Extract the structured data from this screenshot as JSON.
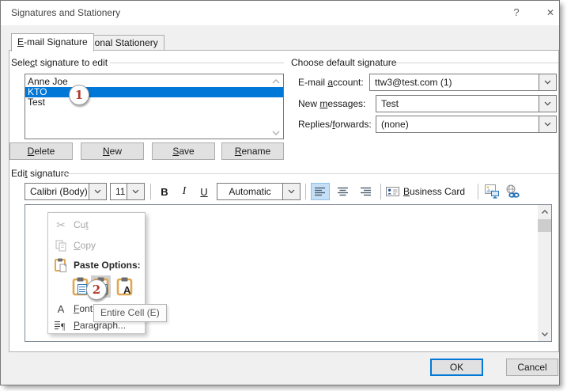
{
  "window": {
    "title": "Signatures and Stationery",
    "help_glyph": "?",
    "close_glyph": "✕"
  },
  "tabs": {
    "email": {
      "pre": "",
      "key": "E",
      "post": "-mail Signature"
    },
    "stationery": {
      "pre": "",
      "key": "P",
      "post": "ersonal Stationery"
    }
  },
  "select_group": {
    "label": {
      "pre": "Sele",
      "key": "c",
      "post": "t signature to edit"
    },
    "items": [
      "Anne Joe",
      "KTO",
      "Test"
    ],
    "selected_item": "KTO",
    "buttons": {
      "delete": {
        "pre": "",
        "key": "D",
        "post": "elete"
      },
      "new": {
        "pre": "",
        "key": "N",
        "post": "ew"
      },
      "save": {
        "pre": "",
        "key": "S",
        "post": "ave"
      },
      "rename": {
        "pre": "",
        "key": "R",
        "post": "ename"
      }
    }
  },
  "default_group": {
    "label": "Choose default signature",
    "email_account": {
      "label": {
        "pre": "E-mail ",
        "key": "a",
        "post": "ccount:"
      },
      "value": "ttw3@test.com (1)"
    },
    "new_messages": {
      "label": {
        "pre": "New ",
        "key": "m",
        "post": "essages:"
      },
      "value": "Test"
    },
    "replies_forwards": {
      "label": {
        "pre": "Replies/",
        "key": "f",
        "post": "orwards:"
      },
      "value": "(none)"
    }
  },
  "edit_group": {
    "label": {
      "pre": "Edi",
      "key": "t",
      "post": " signature"
    },
    "toolbar": {
      "font_name": "Calibri (Body)",
      "font_size": "11",
      "bold": "B",
      "italic": "I",
      "underline": "U",
      "font_color": "Automatic",
      "business_card": {
        "pre": "",
        "key": "B",
        "post": "usiness Card"
      }
    }
  },
  "context_menu": {
    "cut": {
      "pre": "Cu",
      "key": "t",
      "post": ""
    },
    "copy": {
      "pre": "",
      "key": "C",
      "post": "opy"
    },
    "paste_options_label": "Paste Options:",
    "font_item": {
      "pre": "",
      "key": "F",
      "post": "ont..."
    },
    "paragraph_item": {
      "pre": "",
      "key": "P",
      "post": "aragraph..."
    },
    "font_icon_letter": "A"
  },
  "icons": {
    "scissors_glyph": "✂"
  },
  "tooltip_text": "Entire Cell (E)",
  "annotations": {
    "step1": "1",
    "step2": "2"
  },
  "footer": {
    "ok": "OK",
    "cancel": "Cancel"
  },
  "colors": {
    "selection_blue": "#0078d7",
    "annotation_red": "#b03a2e",
    "toolbar_highlight": "#c4dff6",
    "clipboard_tan": "#e0a851"
  }
}
